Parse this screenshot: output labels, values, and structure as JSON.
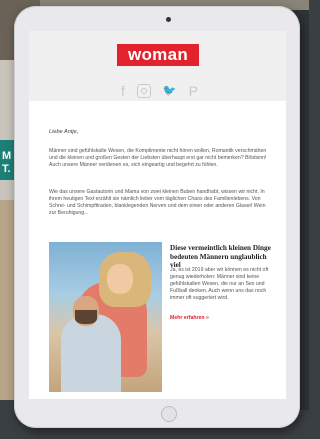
{
  "background_text": "M\nT.",
  "email": {
    "logo": "woman",
    "social_icons": [
      "facebook-icon",
      "instagram-icon",
      "twitter-icon",
      "pinterest-icon"
    ],
    "social_glyphs": {
      "facebook": "f",
      "twitter": "🐦",
      "pinterest": "P"
    },
    "greeting": "Liebe Antje,",
    "paragraph1": "Männer sind gefühlskalte Wesen, die Komplimente nicht hören wollen, Romantik verschmähen und die kleinen und großen Gesten der Liebsten überhaupt erst gar nicht bemerken? Blödsinn! Auch unsere Männer verdienen es, sich eingeartig und begehrt zu fühlen.",
    "paragraph2": "Wie das unsere Gastautorin und Mama von zwei kleinen Buben handhabt, wissen wir nicht. In ihrem heutigen Text erzählt sie nämlich lieber vom täglichen Chaos des Familienlebens. Von Schrei- und Schimpftiraden, blanklegenden Nerven und dem einen oder anderen Glaserl Wein zur Beruhigung...",
    "article": {
      "title": "Diese vermeintlich kleinen Dinge bedeuten Männern unglaublich viel",
      "description": "Ja, es ist 2019 aber wir können es nicht oft genug wiederholen: Männer sind keine gefühlskalten Wesen, die nur an Sex und Fußball denken. Auch wenn uns das noch immer oft suggeriert wird.",
      "read_more": "Mehr erfahren »"
    }
  },
  "colors": {
    "brand": "#e2222c",
    "device": "#e9e9eb"
  }
}
